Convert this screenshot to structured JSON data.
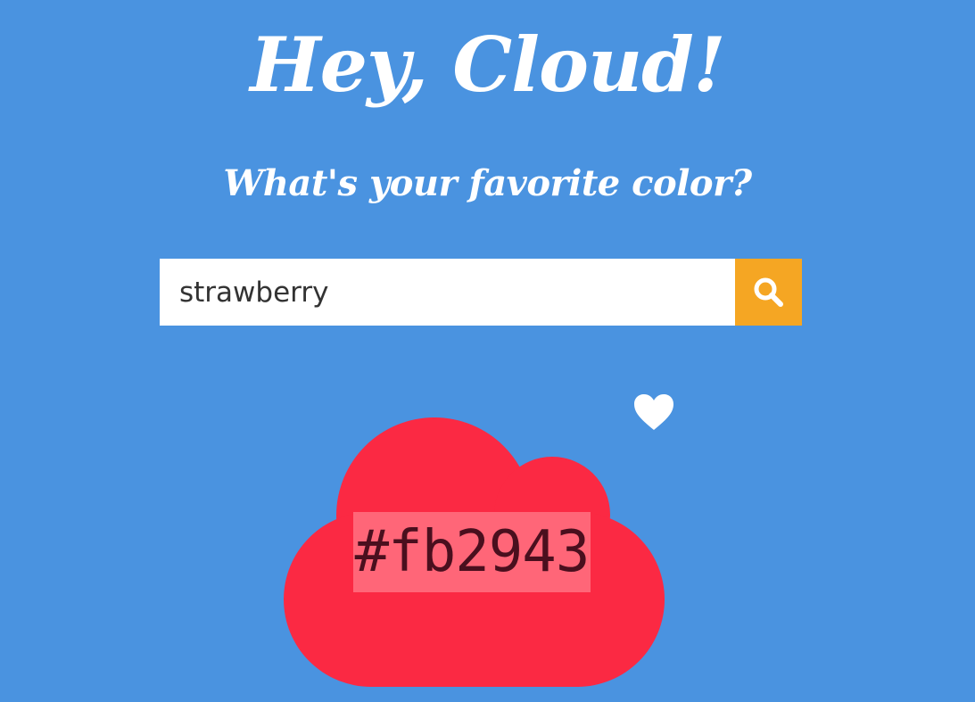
{
  "header": {
    "title": "Hey, Cloud!",
    "subtitle": "What's your favorite color?"
  },
  "search": {
    "value": "strawberry",
    "button_icon": "search-icon"
  },
  "result": {
    "hex": "#fb2943",
    "cloud_icon": "cloud-icon",
    "favorite_icon": "heart-icon"
  },
  "colors": {
    "background": "#4a93e0",
    "button": "#f5a623",
    "cloud": "#fb2943",
    "hex_highlight": "#ff6678",
    "hex_text": "#4a0f1e"
  }
}
